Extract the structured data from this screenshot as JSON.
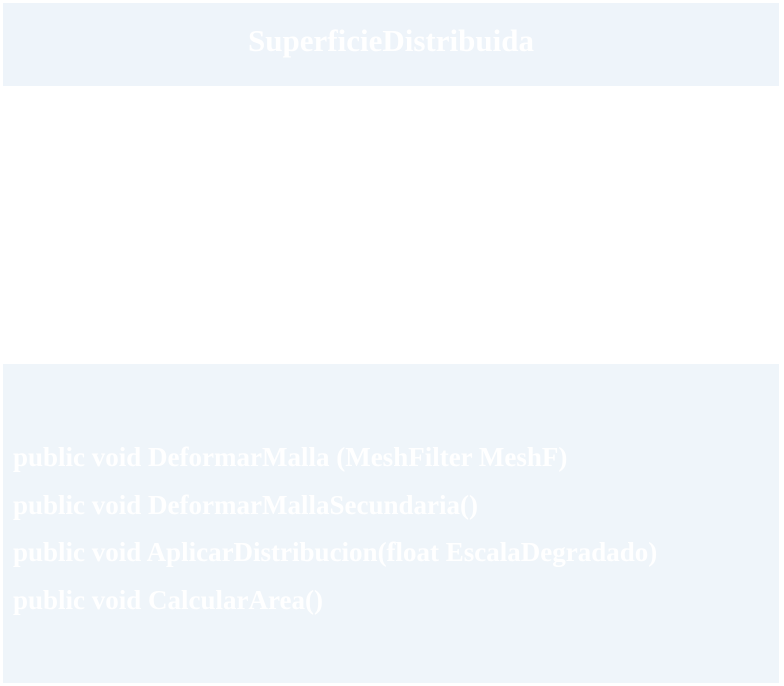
{
  "class": {
    "name": "SuperficieDistribuida",
    "attributes": [],
    "methods": [
      "public void DeformarMalla (MeshFilter MeshF)",
      "public void DeformarMallaSecundaria()",
      "public void AplicarDistribucion(float EscalaDegradado)",
      "public void CalcularArea()"
    ]
  },
  "colors": {
    "header_background": "#eef4fa",
    "methods_background": "#eff5fa",
    "text": "#ffffff"
  }
}
